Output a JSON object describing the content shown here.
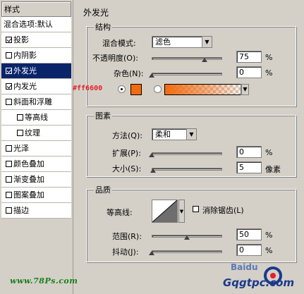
{
  "styles_panel": {
    "title": "样式",
    "items": [
      {
        "label": "混合选项:默认",
        "checkbox": false,
        "checked": false,
        "selected": false,
        "indent": false
      },
      {
        "label": "投影",
        "checkbox": true,
        "checked": true,
        "selected": false,
        "indent": false
      },
      {
        "label": "内阴影",
        "checkbox": true,
        "checked": false,
        "selected": false,
        "indent": false
      },
      {
        "label": "外发光",
        "checkbox": true,
        "checked": true,
        "selected": true,
        "indent": false
      },
      {
        "label": "内发光",
        "checkbox": true,
        "checked": true,
        "selected": false,
        "indent": false
      },
      {
        "label": "斜面和浮雕",
        "checkbox": true,
        "checked": false,
        "selected": false,
        "indent": false
      },
      {
        "label": "等高线",
        "checkbox": true,
        "checked": false,
        "selected": false,
        "indent": true
      },
      {
        "label": "纹理",
        "checkbox": true,
        "checked": false,
        "selected": false,
        "indent": true
      },
      {
        "label": "光泽",
        "checkbox": true,
        "checked": false,
        "selected": false,
        "indent": false
      },
      {
        "label": "颜色叠加",
        "checkbox": true,
        "checked": false,
        "selected": false,
        "indent": false
      },
      {
        "label": "渐变叠加",
        "checkbox": true,
        "checked": false,
        "selected": false,
        "indent": false
      },
      {
        "label": "图案叠加",
        "checkbox": true,
        "checked": false,
        "selected": false,
        "indent": false
      },
      {
        "label": "描边",
        "checkbox": true,
        "checked": false,
        "selected": false,
        "indent": false
      }
    ]
  },
  "outer_glow": {
    "title": "外发光",
    "structure": {
      "title": "结构",
      "blend_mode_label": "混合模式:",
      "blend_mode_value": "滤色",
      "opacity_label": "不透明度(O):",
      "opacity_value": "75",
      "opacity_unit": "%",
      "opacity_level": 0.75,
      "noise_label": "杂色(N):",
      "noise_value": "0",
      "noise_unit": "%",
      "noise_level": 0,
      "color_hex_note": "#ff6600",
      "color": "#f26b0f"
    },
    "elements": {
      "title": "图素",
      "method_label": "方法(Q):",
      "method_value": "柔和",
      "spread_label": "扩展(P):",
      "spread_value": "0",
      "spread_unit": "%",
      "spread_level": 0,
      "size_label": "大小(S):",
      "size_value": "5",
      "size_unit": "像素",
      "size_level": 0.02
    },
    "quality": {
      "title": "品质",
      "contour_label": "等高线:",
      "antialias_label": "消除锯齿(L)",
      "range_label": "范围(R):",
      "range_value": "50",
      "range_unit": "%",
      "range_level": 0.5,
      "jitter_label": "抖动(J):",
      "jitter_value": "0",
      "jitter_unit": "%",
      "jitter_level": 0
    }
  },
  "watermarks": {
    "left": "www.78Ps.com",
    "baidu": "Baidu",
    "right": "Gqgtpc.com"
  }
}
